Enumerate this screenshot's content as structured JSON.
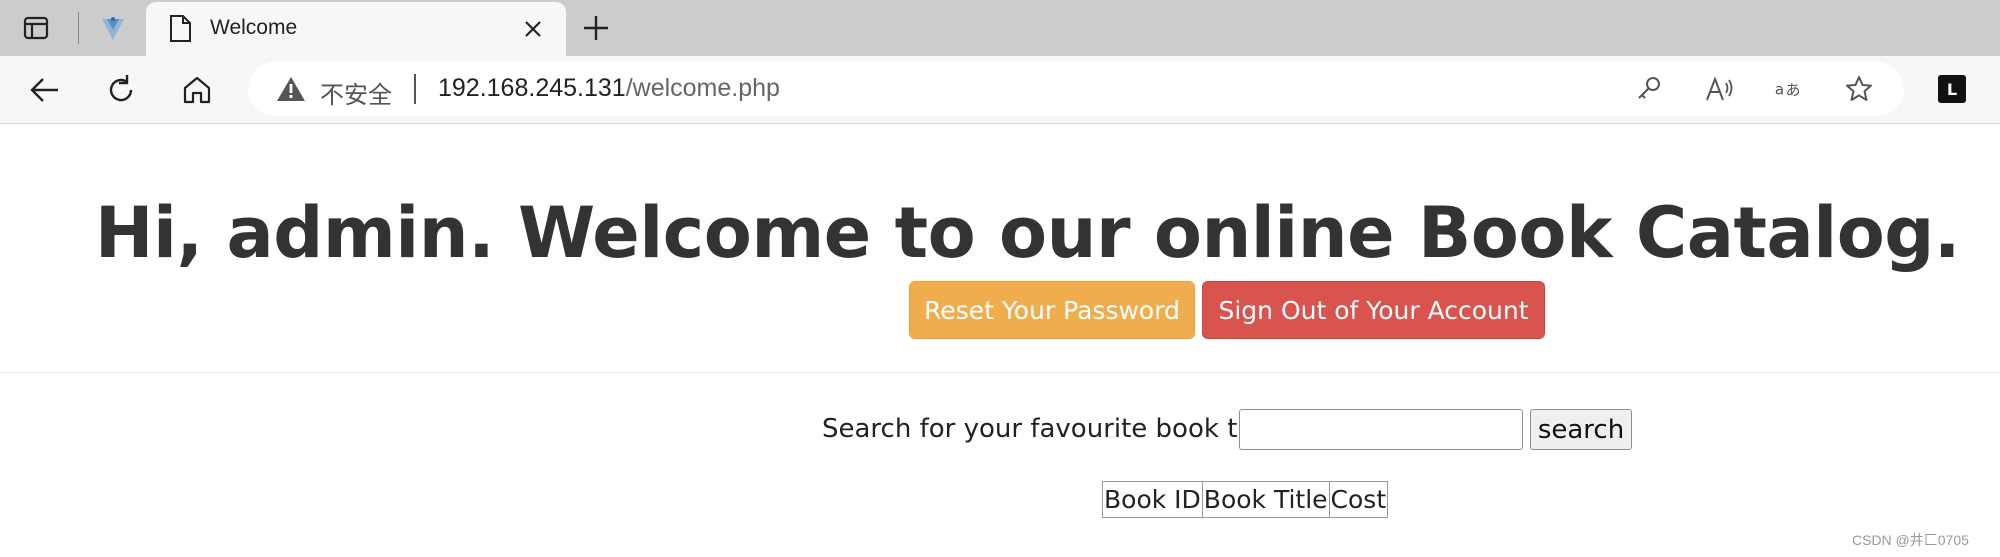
{
  "browser": {
    "tab": {
      "title": "Welcome",
      "close_icon": "close-icon"
    },
    "address": {
      "security_label": "不安全",
      "url_host": "192.168.245.131",
      "url_path": "/welcome.php"
    },
    "extension_badge": "L"
  },
  "page": {
    "greeting_prefix": "Hi, ",
    "username": "admin",
    "greeting_suffix": ". Welcome to our online Book Catalog.",
    "reset_button": "Reset Your Password",
    "signout_button": "Sign Out of Your Account",
    "search_label": "Search for your favourite book title",
    "search_value": "",
    "search_button": "search",
    "table_headers": [
      "Book ID",
      "Book Title",
      "Cost"
    ],
    "colors": {
      "warning": "#f0ad4e",
      "danger": "#d9534f"
    }
  },
  "watermark": "CSDN @井匚0705"
}
